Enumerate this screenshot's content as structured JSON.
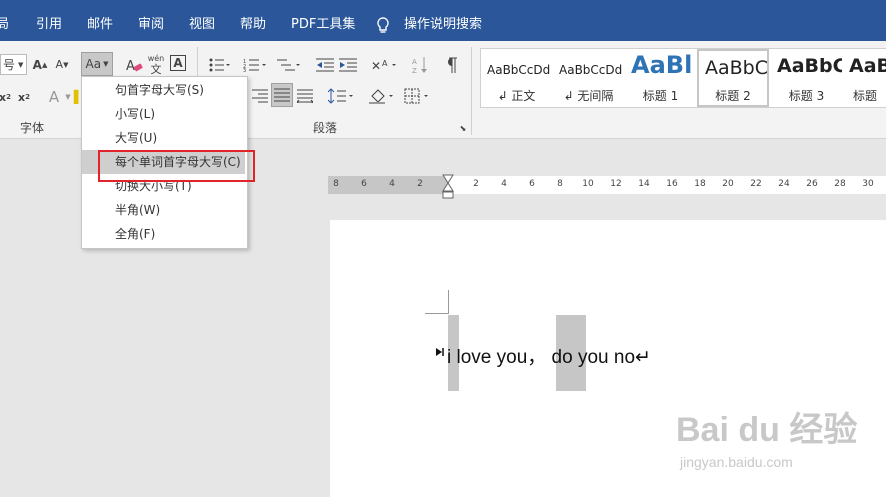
{
  "menubar": {
    "tabs": [
      "局",
      "引用",
      "邮件",
      "审阅",
      "视图",
      "帮助",
      "PDF工具集",
      "操作说明搜索"
    ]
  },
  "ribbon": {
    "font_size_value": "号",
    "change_case_label": "Aa",
    "wen_label": "wén",
    "wen_char": "文",
    "boxed_char": "A",
    "font_group_label": "字体",
    "paragraph_group_label": "段落",
    "styles": [
      {
        "preview": "AaBbCcDd",
        "name": "↲ 正文"
      },
      {
        "preview": "AaBbCcDd",
        "name": "↲ 无间隔"
      },
      {
        "preview": "AaBl",
        "name": "标题 1"
      },
      {
        "preview": "AaBbC",
        "name": "标题 2"
      },
      {
        "preview": "AaBbC",
        "name": "标题 3"
      },
      {
        "preview": "AaBb",
        "name": "标题"
      }
    ]
  },
  "change_case_menu": {
    "items": [
      "句首字母大写(S)",
      "小写(L)",
      "大写(U)",
      "每个单词首字母大写(C)",
      "切换大小写(T)",
      "半角(W)",
      "全角(F)"
    ],
    "highlighted_index": 3
  },
  "ruler": {
    "left_ticks": [
      "8",
      "6",
      "4",
      "2"
    ],
    "right_ticks": [
      "2",
      "4",
      "6",
      "8",
      "10",
      "12",
      "14",
      "16",
      "18",
      "20",
      "22",
      "24",
      "26",
      "28",
      "30"
    ]
  },
  "document": {
    "text": "i love you， do you no↵"
  },
  "watermark": {
    "logo": "Bai du 经验",
    "url": "jingyan.baidu.com"
  },
  "colors": {
    "menubar": "#2b579a",
    "heading_accent": "#2e74b5",
    "highlight_box": "#e0242a"
  }
}
